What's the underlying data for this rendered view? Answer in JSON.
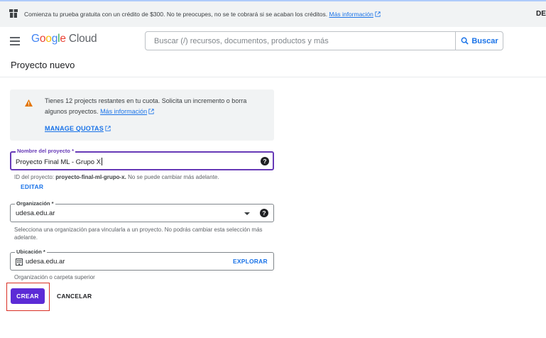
{
  "banner": {
    "message": "Comienza tu prueba gratuita con un crédito de $300. No te preocupes, no se te cobrará si se acaban los créditos.",
    "link": "Más información",
    "dismiss": "DE"
  },
  "header": {
    "logo_google": [
      "G",
      "o",
      "o",
      "g",
      "l",
      "e"
    ],
    "logo_cloud": "Cloud",
    "search_placeholder": "Buscar (/) recursos, documentos, productos y más",
    "search_button": "Buscar"
  },
  "page": {
    "title": "Proyecto nuevo"
  },
  "quota": {
    "message": "Tienes 12 projects restantes en tu cuota. Solicita un incremento o borra algunos proyectos.",
    "link": "Más información",
    "manage": "MANAGE QUOTAS"
  },
  "project_name": {
    "label": "Nombre del proyecto *",
    "value": "Proyecto Final ML - Grupo X",
    "id_prefix": "ID del proyecto:",
    "id_value": "proyecto-final-ml-grupo-x.",
    "id_note": "No se puede cambiar más adelante.",
    "edit": "EDITAR"
  },
  "organization": {
    "label": "Organización *",
    "value": "udesa.edu.ar",
    "hint": "Selecciona una organización para vincularla a un proyecto. No podrás cambiar esta selección más adelante."
  },
  "location": {
    "label": "Ubicación *",
    "value": "udesa.edu.ar",
    "browse": "EXPLORAR",
    "hint": "Organización o carpeta superior"
  },
  "actions": {
    "create": "CREAR",
    "cancel": "CANCELAR"
  },
  "colors": {
    "accent": "#673ab7",
    "primary_button": "#5c2bd6",
    "link": "#1a73e8",
    "warning": "#e37400",
    "highlight": "#d93025"
  }
}
